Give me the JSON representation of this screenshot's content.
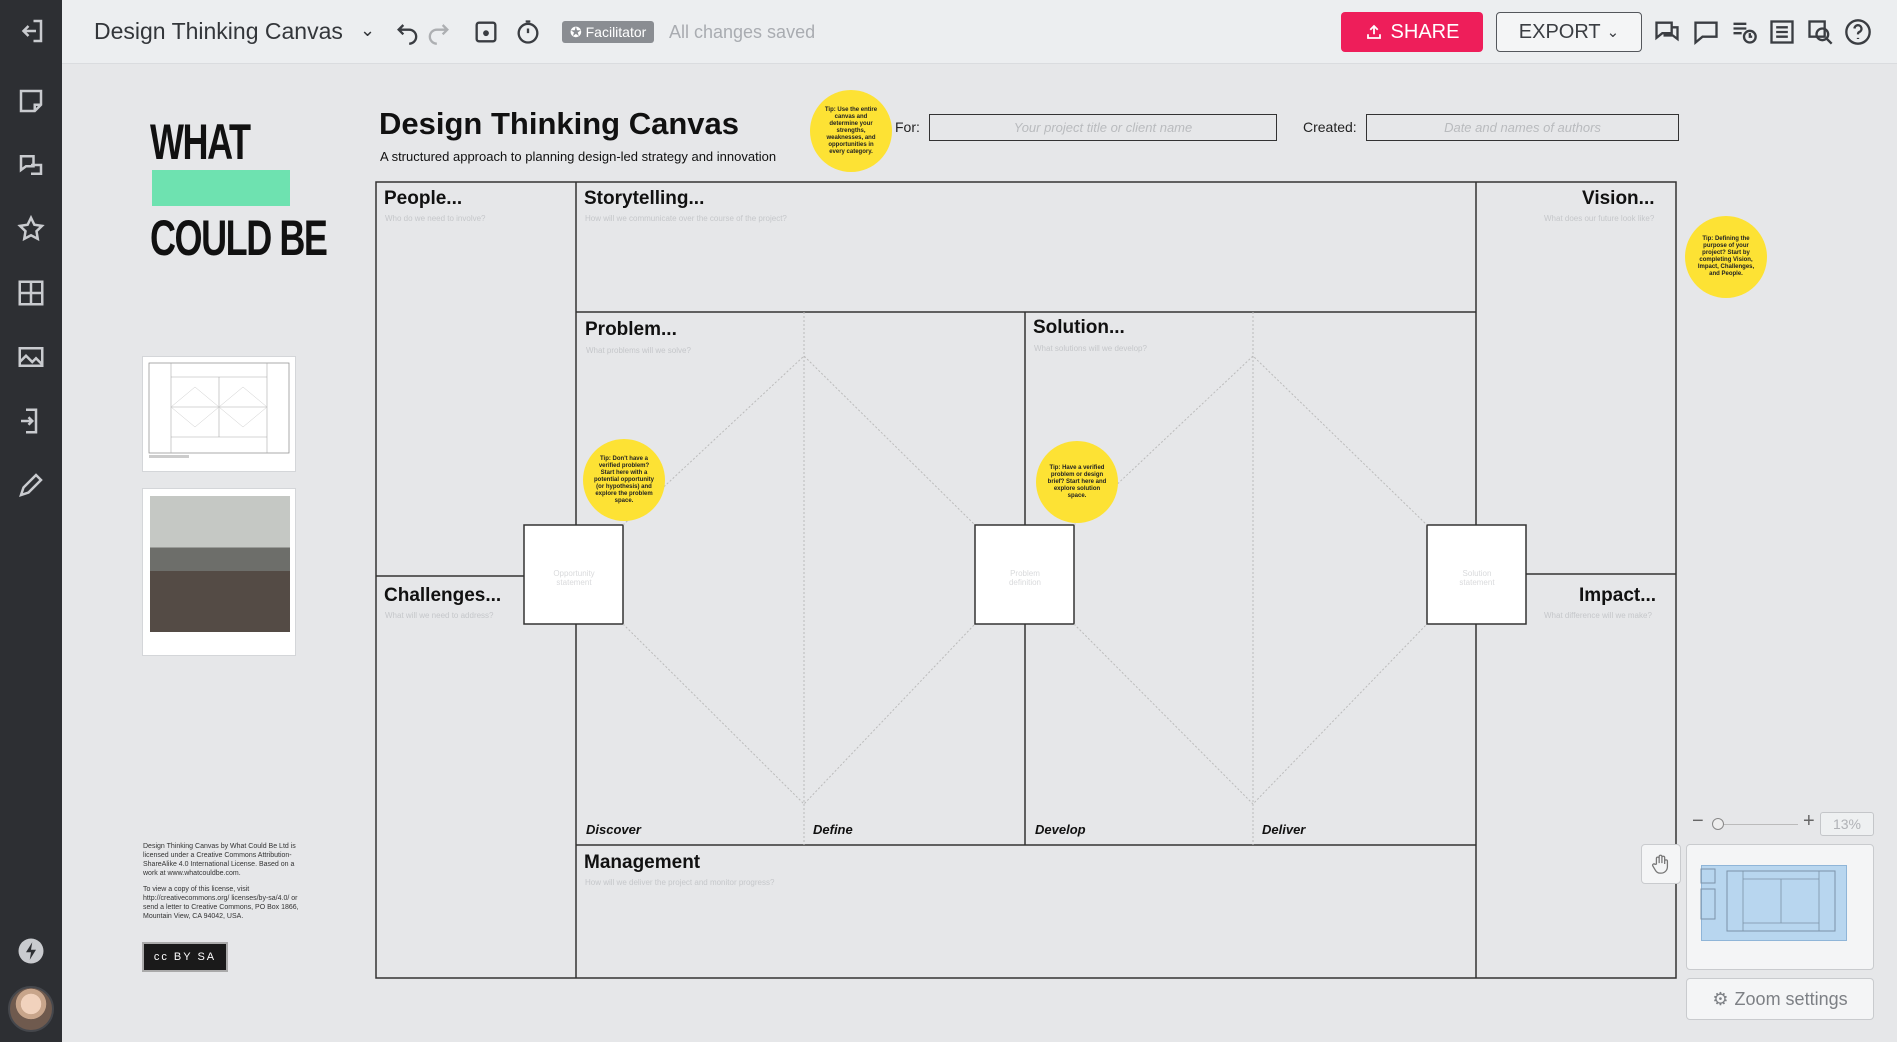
{
  "topbar": {
    "board_title": "Design Thinking Canvas",
    "facilitator_label": "Facilitator",
    "save_status": "All changes saved",
    "share_label": "SHARE",
    "export_label": "EXPORT"
  },
  "rail": {
    "icons": [
      "exit-icon",
      "sticky-note-icon",
      "comment-shape-icon",
      "star-icon",
      "grid-icon",
      "image-icon",
      "import-icon",
      "pen-icon",
      "lightning-icon"
    ]
  },
  "sidebar_art": {
    "logo_line1": "WHAT",
    "logo_line2": "COULD BE",
    "license_text_1": "Design Thinking Canvas by What Could Be Ltd is licensed under a Creative Commons Attribution-ShareAlike 4.0 International License. Based on a work at www.whatcouldbe.com.",
    "license_text_2": "To view a copy of this license, visit http://creativecommons.org/ licenses/by-sa/4.0/ or send a letter to Creative Commons, PO Box 1866, Mountain View, CA 94042, USA.",
    "cc_badge": "cc BY SA"
  },
  "canvas": {
    "title": "Design Thinking Canvas",
    "subtitle": "A structured approach to planning design-led strategy and innovation",
    "for_label": "For:",
    "for_placeholder": "Your project title or client name",
    "created_label": "Created:",
    "created_placeholder": "Date and names of authors",
    "sections": {
      "people": {
        "title": "People...",
        "sub": "Who do we need to involve?"
      },
      "storytelling": {
        "title": "Storytelling...",
        "sub": "How will we communicate over the course of the project?"
      },
      "vision": {
        "title": "Vision...",
        "sub": "What does our future look like?"
      },
      "problem": {
        "title": "Problem...",
        "sub": "What problems will we solve?"
      },
      "solution": {
        "title": "Solution...",
        "sub": "What solutions will we develop?"
      },
      "challenges": {
        "title": "Challenges...",
        "sub": "What will we need to address?"
      },
      "impact": {
        "title": "Impact...",
        "sub": "What difference will we make?"
      },
      "management": {
        "title": "Management",
        "sub": "How will we deliver the project and monitor progress?"
      }
    },
    "phases": [
      "Discover",
      "Define",
      "Develop",
      "Deliver"
    ],
    "hinges": [
      {
        "title": "Opportunity",
        "sub": "statement"
      },
      {
        "title": "Problem",
        "sub": "definition"
      },
      {
        "title": "Solution",
        "sub": "statement"
      }
    ],
    "tips": {
      "top": "Tip: Use the entire canvas and determine your strengths, weaknesses, and opportunities in every category.",
      "vision": "Tip: Defining the purpose of your project? Start by completing Vision, Impact, Challenges, and People.",
      "problem": "Tip: Don't have a verified problem? Start here with a potential opportunity (or hypothesis) and explore the problem space.",
      "solution": "Tip: Have a verified problem or design brief? Start here and explore solution space."
    }
  },
  "zoom": {
    "value": "13%",
    "settings_label": "Zoom settings"
  }
}
